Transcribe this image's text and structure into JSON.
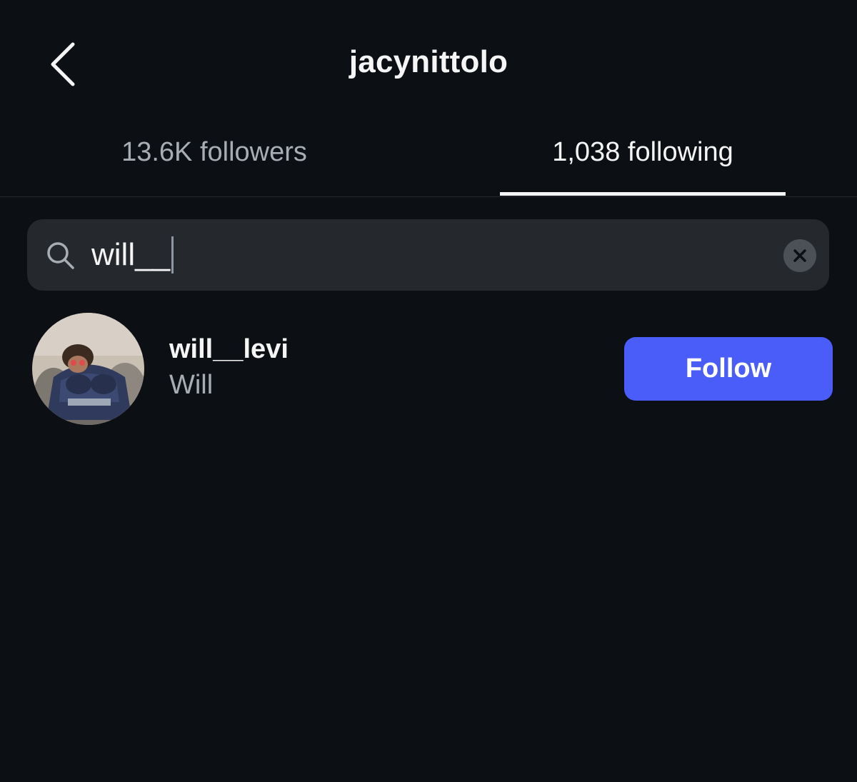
{
  "header": {
    "title": "jacynittolo",
    "back_icon": "chevron-left-icon"
  },
  "tabs": [
    {
      "label": "13.6K followers",
      "active": false
    },
    {
      "label": "1,038 following",
      "active": true
    }
  ],
  "search": {
    "value": "will__",
    "search_icon": "search-icon",
    "clear_icon": "close-icon"
  },
  "results": [
    {
      "username": "will__levi",
      "full_name": "Will",
      "button_label": "Follow"
    }
  ],
  "colors": {
    "background": "#0c1014",
    "accent": "#4a5df9",
    "search_bg": "#25292e",
    "secondary_text": "#a8adb3"
  }
}
